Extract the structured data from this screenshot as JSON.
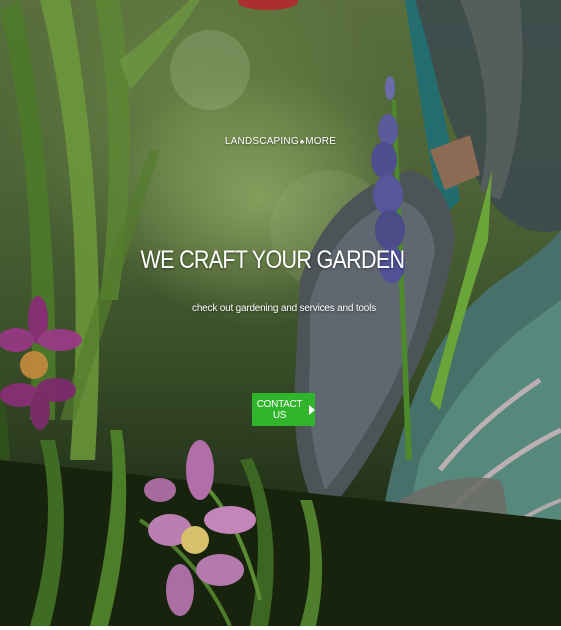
{
  "hero": {
    "tagline_left": "LANDSCAPING",
    "tagline_icon": "leaf-icon",
    "tagline_right": "MORE",
    "headline": "WE CRAFT YOUR GARDEN",
    "subline": "check out gardening and services and tools",
    "cta_label": "CONTACT US",
    "cta_icon": "play-arrow-icon"
  },
  "colors": {
    "cta_background": "#2fb42b",
    "text": "#ffffff"
  }
}
